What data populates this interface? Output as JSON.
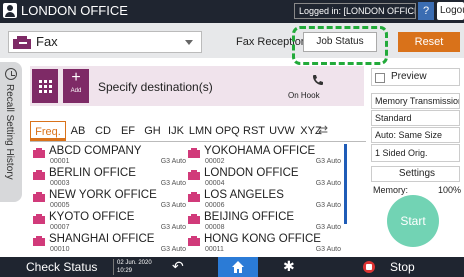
{
  "topbar": {
    "office_title": "LONDON OFFICE",
    "logged_in": "Logged in: [LONDON OFFICE]",
    "help": "?",
    "logout": "Logout"
  },
  "mode": {
    "function": "Fax",
    "fax_reception": "Fax Reception",
    "job_status": "Job Status",
    "reset": "Reset"
  },
  "side_tab": {
    "label": "Recall Setting History"
  },
  "destination": {
    "add_label": "Add",
    "specify": "Specify destination(s)",
    "on_hook": "On Hook"
  },
  "tabs": [
    {
      "label": "Freq."
    },
    {
      "label": "AB"
    },
    {
      "label": "CD"
    },
    {
      "label": "EF"
    },
    {
      "label": "GH"
    },
    {
      "label": "IJK"
    },
    {
      "label": "LMN"
    },
    {
      "label": "OPQ"
    },
    {
      "label": "RST"
    },
    {
      "label": "UVW"
    },
    {
      "label": "XYZ"
    }
  ],
  "addresses": [
    {
      "name": "ABCD COMPANY",
      "number": "00001",
      "type": "G3 Auto"
    },
    {
      "name": "YOKOHAMA OFFICE",
      "number": "00002",
      "type": "G3 Auto"
    },
    {
      "name": "BERLIN OFFICE",
      "number": "00003",
      "type": "G3 Auto"
    },
    {
      "name": "LONDON OFFICE",
      "number": "00004",
      "type": "G3 Auto"
    },
    {
      "name": "NEW YORK OFFICE",
      "number": "00005",
      "type": "G3 Auto"
    },
    {
      "name": "LOS ANGELES",
      "number": "00006",
      "type": "G3 Auto"
    },
    {
      "name": "KYOTO OFFICE",
      "number": "00007",
      "type": "G3 Auto"
    },
    {
      "name": "BEIJING OFFICE",
      "number": "00008",
      "type": "G3 Auto"
    },
    {
      "name": "SHANGHAI OFFICE",
      "number": "00010",
      "type": "G3 Auto"
    },
    {
      "name": "HONG KONG OFFICE",
      "number": "00011",
      "type": "G3 Auto"
    }
  ],
  "right_panel": {
    "preview": "Preview",
    "memory_transmission": "Memory Transmission",
    "resolution": "Standard",
    "size": "Auto: Same Size",
    "sides": "1 Sided Orig.",
    "settings": "Settings",
    "memory_label": "Memory:",
    "memory_value": "100%",
    "start": "Start"
  },
  "bottombar": {
    "check_status": "Check Status",
    "date": "02 Jun. 2020",
    "time": "10:29",
    "stop": "Stop"
  },
  "colors": {
    "accent": "#d9721a",
    "fax_purple": "#7e2a66",
    "start_green": "#72d3b4",
    "highlight_green": "#22aa3a",
    "home_blue": "#2b7bd6"
  }
}
